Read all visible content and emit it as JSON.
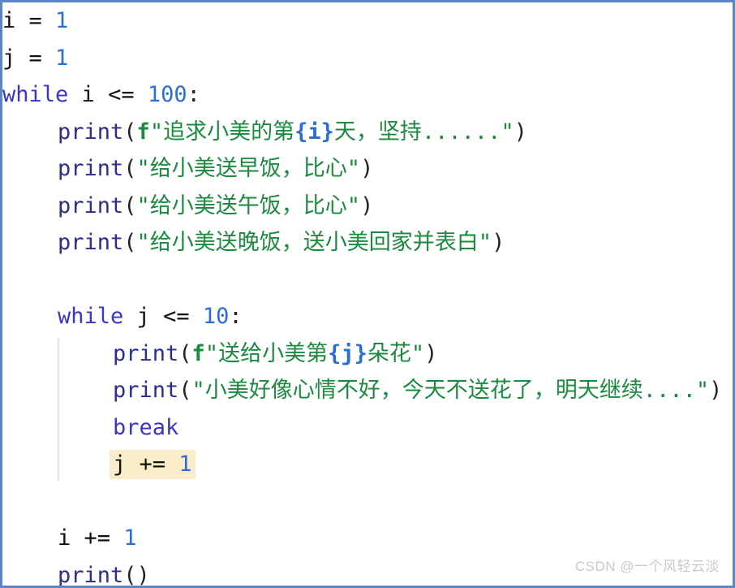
{
  "window": {
    "kind": "code-snippet-image",
    "border_color": "#5b85c3",
    "background_color": "#ffffff"
  },
  "theme": {
    "keyword_color": "#3a36c4",
    "number_color": "#2b6fd6",
    "function_color": "#2d2d8e",
    "string_color": "#1a8a3f",
    "fstring_expr_color": "#2b6fd6",
    "identifier_color": "#111111",
    "highlight_background": "#faecc8",
    "indent_guide_color": "#e3e3e3",
    "watermark_color": "#c9c9c9"
  },
  "code": {
    "language": "python",
    "lines": [
      {
        "indent": 0,
        "text": "i = 1"
      },
      {
        "indent": 0,
        "text": "j = 1"
      },
      {
        "indent": 0,
        "text": "while i <= 100:"
      },
      {
        "indent": 1,
        "text": "print(f\"追求小美的第{i}天，坚持......\")"
      },
      {
        "indent": 1,
        "text": "print(\"给小美送早饭，比心\")"
      },
      {
        "indent": 1,
        "text": "print(\"给小美送午饭，比心\")"
      },
      {
        "indent": 1,
        "text": "print(\"给小美送晚饭，送小美回家并表白\")"
      },
      {
        "indent": 0,
        "text": ""
      },
      {
        "indent": 1,
        "text": "while j <= 10:"
      },
      {
        "indent": 2,
        "text": "print(f\"送给小美第{j}朵花\")"
      },
      {
        "indent": 2,
        "text": "print(\"小美好像心情不好，今天不送花了，明天继续....\")"
      },
      {
        "indent": 2,
        "text": "break"
      },
      {
        "indent": 2,
        "text": "j += 1",
        "highlighted": true
      },
      {
        "indent": 0,
        "text": ""
      },
      {
        "indent": 1,
        "text": "i += 1"
      },
      {
        "indent": 1,
        "text": "print()"
      }
    ]
  },
  "tokens": {
    "line_0": [
      {
        "t": "i",
        "c": "tok-name"
      },
      {
        "t": " = ",
        "c": "tok-op"
      },
      {
        "t": "1",
        "c": "tok-num"
      }
    ],
    "line_1": [
      {
        "t": "j",
        "c": "tok-name"
      },
      {
        "t": " = ",
        "c": "tok-op"
      },
      {
        "t": "1",
        "c": "tok-num"
      }
    ],
    "line_2": [
      {
        "t": "while",
        "c": "tok-kw"
      },
      {
        "t": " i ",
        "c": "tok-name"
      },
      {
        "t": "<=",
        "c": "tok-op"
      },
      {
        "t": " ",
        "c": "tok-op"
      },
      {
        "t": "100",
        "c": "tok-num"
      },
      {
        "t": ":",
        "c": "tok-punct"
      }
    ],
    "line_3": [
      {
        "t": "print",
        "c": "tok-fn"
      },
      {
        "t": "(",
        "c": "tok-punct"
      },
      {
        "t": "f",
        "c": "tok-fprefix"
      },
      {
        "t": "\"追求小美的第",
        "c": "tok-str"
      },
      {
        "t": "{i}",
        "c": "tok-fexpr"
      },
      {
        "t": "天，坚持......\"",
        "c": "tok-str"
      },
      {
        "t": ")",
        "c": "tok-punct"
      }
    ],
    "line_4": [
      {
        "t": "print",
        "c": "tok-fn"
      },
      {
        "t": "(",
        "c": "tok-punct"
      },
      {
        "t": "\"给小美送早饭，比心\"",
        "c": "tok-str"
      },
      {
        "t": ")",
        "c": "tok-punct"
      }
    ],
    "line_5": [
      {
        "t": "print",
        "c": "tok-fn"
      },
      {
        "t": "(",
        "c": "tok-punct"
      },
      {
        "t": "\"给小美送午饭，比心\"",
        "c": "tok-str"
      },
      {
        "t": ")",
        "c": "tok-punct"
      }
    ],
    "line_6": [
      {
        "t": "print",
        "c": "tok-fn"
      },
      {
        "t": "(",
        "c": "tok-punct"
      },
      {
        "t": "\"给小美送晚饭，送小美回家并表白\"",
        "c": "tok-str"
      },
      {
        "t": ")",
        "c": "tok-punct"
      }
    ],
    "line_7": [],
    "line_8": [
      {
        "t": "while",
        "c": "tok-kw"
      },
      {
        "t": " j ",
        "c": "tok-name"
      },
      {
        "t": "<=",
        "c": "tok-op"
      },
      {
        "t": " ",
        "c": "tok-op"
      },
      {
        "t": "10",
        "c": "tok-num"
      },
      {
        "t": ":",
        "c": "tok-punct"
      }
    ],
    "line_9": [
      {
        "t": "print",
        "c": "tok-fn"
      },
      {
        "t": "(",
        "c": "tok-punct"
      },
      {
        "t": "f",
        "c": "tok-fprefix"
      },
      {
        "t": "\"送给小美第",
        "c": "tok-str"
      },
      {
        "t": "{j}",
        "c": "tok-fexpr"
      },
      {
        "t": "朵花\"",
        "c": "tok-str"
      },
      {
        "t": ")",
        "c": "tok-punct"
      }
    ],
    "line_10": [
      {
        "t": "print",
        "c": "tok-fn"
      },
      {
        "t": "(",
        "c": "tok-punct"
      },
      {
        "t": "\"小美好像心情不好，今天不送花了，明天继续....\"",
        "c": "tok-str"
      },
      {
        "t": ")",
        "c": "tok-punct"
      }
    ],
    "line_11": [
      {
        "t": "break",
        "c": "tok-kw"
      }
    ],
    "line_12": [
      {
        "t": "j",
        "c": "tok-name"
      },
      {
        "t": " += ",
        "c": "tok-op"
      },
      {
        "t": "1",
        "c": "tok-num"
      }
    ],
    "line_13": [],
    "line_14": [
      {
        "t": "i",
        "c": "tok-name"
      },
      {
        "t": " += ",
        "c": "tok-op"
      },
      {
        "t": "1",
        "c": "tok-num"
      }
    ],
    "line_15": [
      {
        "t": "print",
        "c": "tok-fn"
      },
      {
        "t": "()",
        "c": "tok-punct"
      }
    ]
  },
  "watermark": {
    "text": "CSDN @一个风轻云淡"
  }
}
